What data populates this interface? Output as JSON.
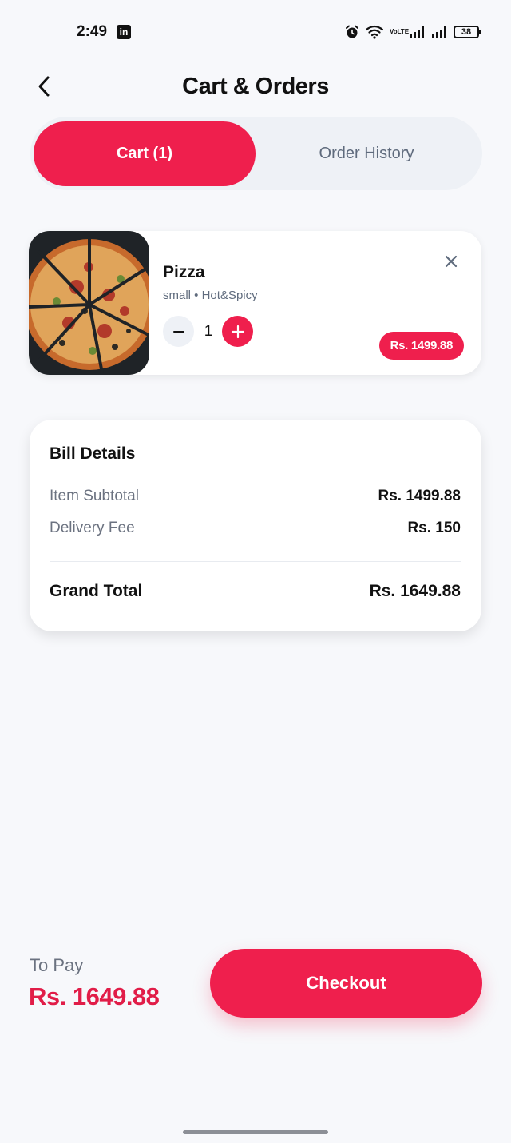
{
  "status_bar": {
    "time": "2:49",
    "app_badge": "in",
    "network_label": "VoLTE",
    "battery": "38"
  },
  "header": {
    "title": "Cart & Orders"
  },
  "tabs": [
    {
      "label": "Cart (1)",
      "active": true
    },
    {
      "label": "Order History",
      "active": false
    }
  ],
  "cart": {
    "items": [
      {
        "name": "Pizza",
        "options": "small • Hot&Spicy",
        "quantity": "1",
        "price": "Rs. 1499.88",
        "image": "pizza-photo"
      }
    ]
  },
  "bill": {
    "title": "Bill Details",
    "subtotal_label": "Item Subtotal",
    "subtotal_value": "Rs. 1499.88",
    "delivery_label": "Delivery Fee",
    "delivery_value": "Rs. 150",
    "total_label": "Grand Total",
    "total_value": "Rs. 1649.88"
  },
  "footer": {
    "to_pay_label": "To Pay",
    "to_pay_amount": "Rs. 1649.88",
    "checkout_label": "Checkout"
  },
  "colors": {
    "accent": "#ef1f4d",
    "background": "#f7f8fb",
    "muted_text": "#5f6b7d",
    "tab_track": "#eef1f6"
  }
}
